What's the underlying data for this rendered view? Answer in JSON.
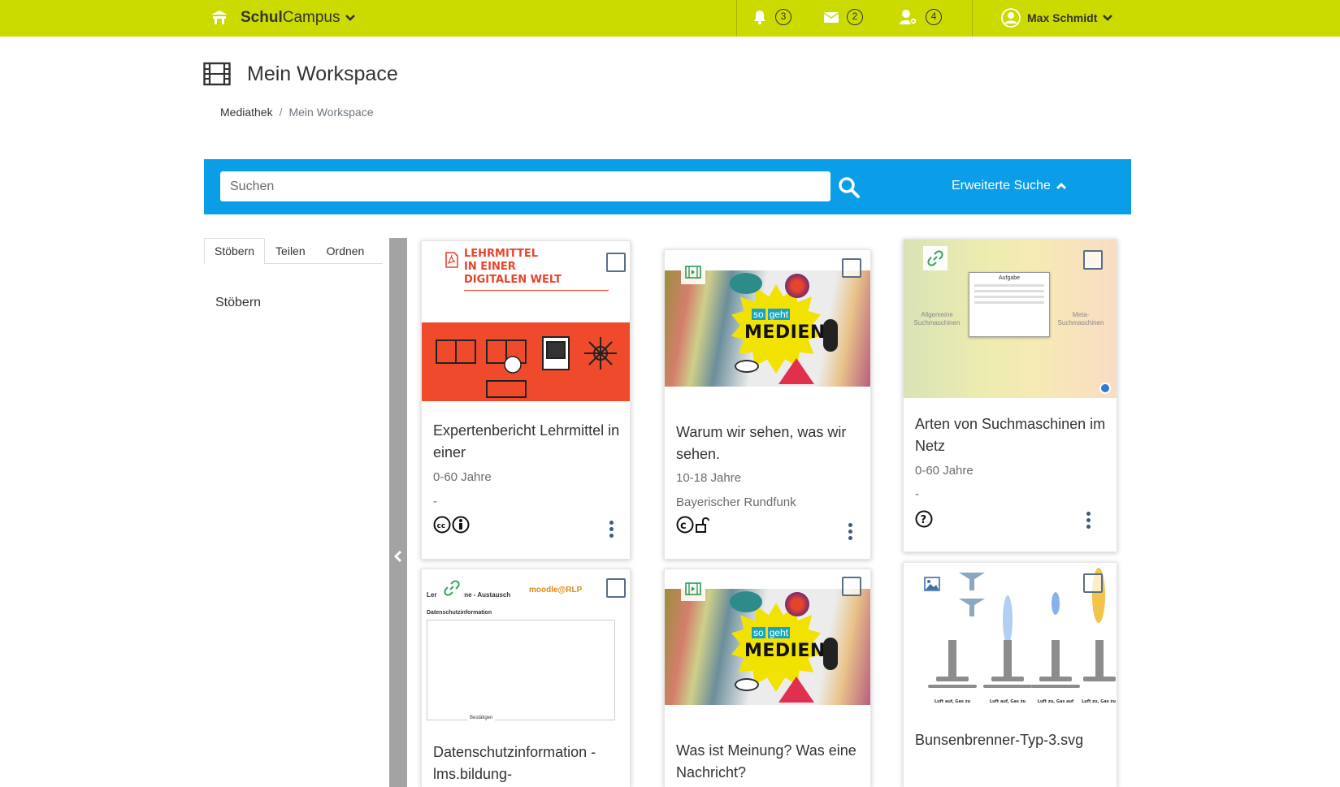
{
  "app": {
    "brand_bold": "Schul",
    "brand_rest": "Campus"
  },
  "nav": {
    "notifications_count": "3",
    "messages_count": "2",
    "requests_count": "4",
    "user_name": "Max Schmidt"
  },
  "header": {
    "title": "Mein Workspace"
  },
  "breadcrumb": {
    "items": [
      "Mediathek",
      "Mein Workspace"
    ]
  },
  "search": {
    "placeholder": "Suchen",
    "advanced_label": "Erweiterte Suche"
  },
  "sidebar": {
    "tabs": [
      "Stöbern",
      "Teilen",
      "Ordnen"
    ],
    "active_tab": "Stöbern",
    "content_title": "Stöbern"
  },
  "cards": [
    {
      "type": "pdf-icon",
      "thumb_text": [
        "LEHRMITTEL",
        "IN EINER",
        "DIGITALEN WELT"
      ],
      "title": "Expertenbericht Lehrmittel in einer",
      "age": "0-60 Jahre",
      "extra": "-",
      "license": "cc-by"
    },
    {
      "type": "video-icon",
      "thumb_text": [
        "so",
        "geht",
        "MEDIEN"
      ],
      "title": "Warum wir sehen, was wir sehen.",
      "age": "10-18 Jahre",
      "publisher": "Bayerischer Rundfunk",
      "license": "copyright-open"
    },
    {
      "type": "link-icon",
      "thumb_text": [
        "Aufgabe",
        "Allgemeine Suchmaschinen",
        "Meta-Suchmaschinen"
      ],
      "title": "Arten von Suchmaschinen im Netz",
      "age": "0-60 Jahre",
      "extra": "-",
      "license": "unknown"
    },
    {
      "type": "link-icon",
      "thumb_text": [
        "Ler",
        "ine - Austausch",
        "moodle@RLP",
        "Datenschutzinformation",
        "Bestätigen"
      ],
      "title": "Datenschutzinformation - lms.bildung-"
    },
    {
      "type": "video-icon",
      "thumb_text": [
        "so",
        "geht",
        "MEDIEN"
      ],
      "title": "Was ist Meinung? Was eine Nachricht?"
    },
    {
      "type": "image-icon",
      "thumb_text": [
        "Luft auf, Gas zu",
        "Luft auf, Gas zu",
        "Luft zu, Gas auf",
        "Luft zu, Gas zu"
      ],
      "title": "Bunsenbrenner-Typ-3.svg"
    }
  ],
  "colors": {
    "topbar": "#cbdb00",
    "searchbar": "#0a9ee8",
    "collapse_bar": "#a3a3a3",
    "checkbox": "#5a6f86"
  }
}
